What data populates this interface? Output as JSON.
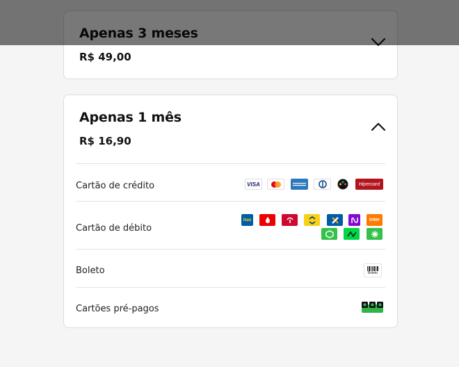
{
  "plans": [
    {
      "title": "Apenas 3 meses",
      "price": "R$ 49,00",
      "expanded": false
    },
    {
      "title": "Apenas 1 mês",
      "price": "R$ 16,90",
      "expanded": true
    }
  ],
  "payment_methods": {
    "credit": {
      "label": "Cartão de crédito",
      "brands": [
        {
          "name": "visa",
          "text": "VISA"
        },
        {
          "name": "mastercard",
          "text": ""
        },
        {
          "name": "amex",
          "text": ""
        },
        {
          "name": "diners",
          "text": ""
        },
        {
          "name": "elo",
          "text": "elo"
        },
        {
          "name": "hipercard",
          "text": "Hipercard"
        }
      ]
    },
    "debit": {
      "label": "Cartão de débito",
      "brands": [
        {
          "name": "itau",
          "text": "itaú"
        },
        {
          "name": "santander",
          "text": ""
        },
        {
          "name": "bradesco",
          "text": ""
        },
        {
          "name": "banco-do-brasil",
          "text": ""
        },
        {
          "name": "caixa",
          "text": ""
        },
        {
          "name": "nubank",
          "text": ""
        },
        {
          "name": "inter",
          "text": "inter"
        },
        {
          "name": "picpay-green",
          "text": ""
        },
        {
          "name": "pagbank",
          "text": ""
        },
        {
          "name": "sicredi",
          "text": ""
        }
      ]
    },
    "boleto": {
      "label": "Boleto",
      "icon_text": "Boleto"
    },
    "prepaid": {
      "label": "Cartões pré-pagos"
    }
  },
  "colors": {
    "visa": "#1a1f71",
    "amex": "#2e77bc",
    "hipercard": "#b3131b",
    "itau": "#ec7000",
    "santander": "#ec0000",
    "bradesco": "#cc092f",
    "bb": "#f8d117",
    "caixa": "#005ca9",
    "nubank": "#820ad1",
    "inter": "#ff7a00",
    "green": "#35c04a"
  }
}
